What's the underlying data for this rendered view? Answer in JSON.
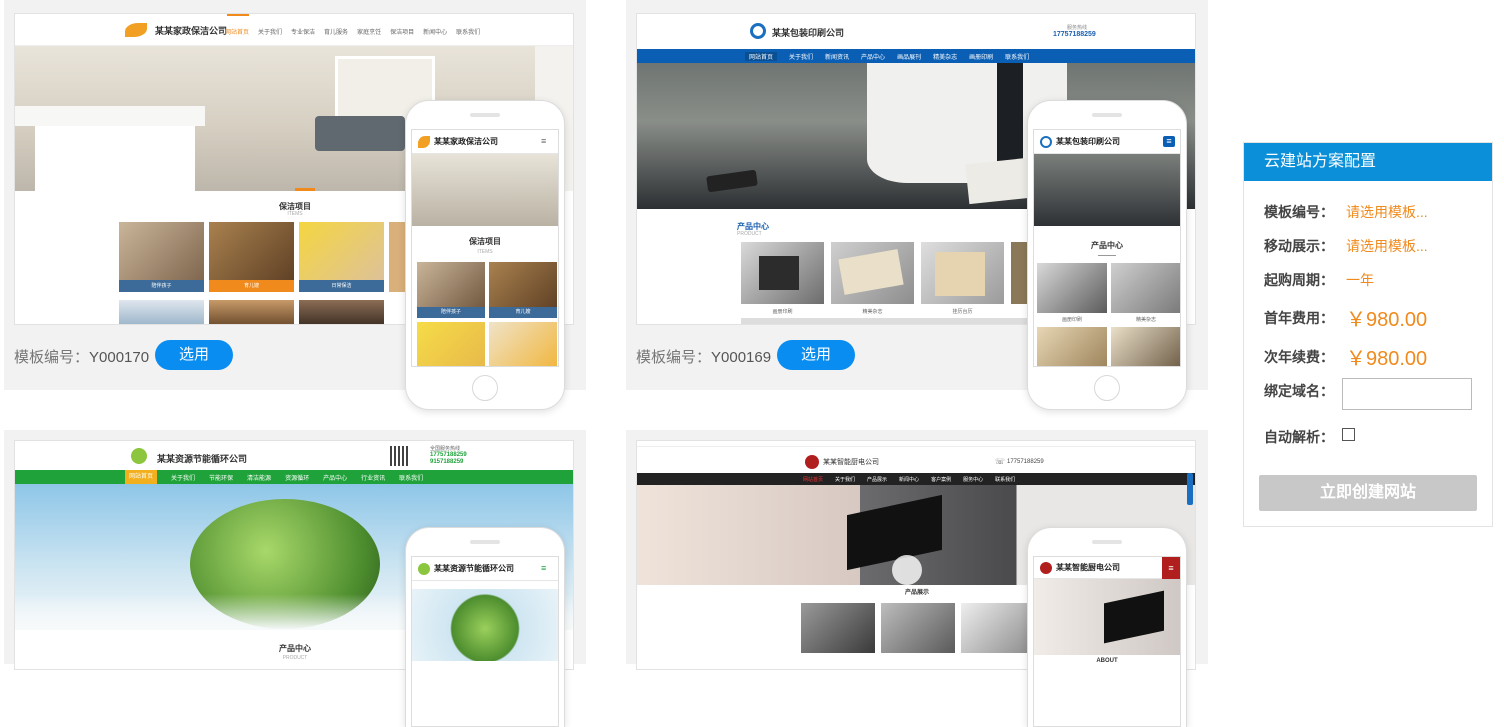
{
  "templates": [
    {
      "code_label": "模板编号：",
      "code": "Y000170",
      "select_label": "选用",
      "site_name": "某某家政保洁公司",
      "nav": [
        "网站首页",
        "关于我们",
        "专业保洁",
        "育儿服务",
        "家庭烹饪",
        "保洁项目",
        "新闻中心",
        "联系我们"
      ],
      "section_title": "保洁项目",
      "section_sub": "ITEMS",
      "tiles": [
        "陪伴孩子",
        "育儿嫂",
        "日常保洁"
      ],
      "mobile_section": "保洁项目",
      "mobile_sub": "ITEMS",
      "mobile_tiles": [
        "陪伴孩子",
        "育儿嫂"
      ]
    },
    {
      "code_label": "模板编号：",
      "code": "Y000169",
      "select_label": "选用",
      "site_name": "某某包装印刷公司",
      "phone_label": "服务热线",
      "phone": "17757188259",
      "nav": [
        "网站首页",
        "关于我们",
        "新闻资讯",
        "产品中心",
        "画品展刊",
        "精美杂志",
        "画册印刷",
        "联系我们"
      ],
      "section_title": "产品中心",
      "section_sub": "PRODUCT",
      "tiles": [
        "画册印刷",
        "精美杂志",
        "挂历台历"
      ],
      "mobile_section": "产品中心",
      "mobile_tiles": [
        "画册印刷",
        "精美杂志"
      ]
    },
    {
      "site_name": "某某资源节能循环公司",
      "phone_label": "全国服务热线",
      "phone": "17757188259",
      "phone2": "9157188259",
      "nav": [
        "网站首页",
        "关于我们",
        "节能环保",
        "清洁能源",
        "资源循环",
        "产品中心",
        "行业资讯",
        "联系我们"
      ],
      "section_title": "产品中心",
      "section_sub": "PRODUCT"
    },
    {
      "site_name": "某某智能厨电公司",
      "phone": "17757188259",
      "nav": [
        "网站首页",
        "关于我们",
        "产品展示",
        "新闻中心",
        "客户案例",
        "服务中心",
        "联系我们"
      ],
      "section_title": "产品展示",
      "mobile_section": "ABOUT"
    }
  ],
  "sidebar": {
    "title": "云建站方案配置",
    "template_code_label": "模板编号：",
    "template_code_value": "请选用模板...",
    "mobile_label": "移动展示：",
    "mobile_value": "请选用模板...",
    "period_label": "起购周期：",
    "period_value": "一年",
    "first_year_label": "首年费用：",
    "first_year_value": "￥980.00",
    "renew_label": "次年续费：",
    "renew_value": "￥980.00",
    "domain_label": "绑定域名：",
    "autoresolve_label": "自动解析：",
    "create_label": "立即创建网站"
  },
  "colors": {
    "accent": "#0a8df0",
    "panel_header": "#0a8fd8",
    "price": "#f08a1c",
    "nav_blue": "#0a5fb4",
    "nav_green": "#1fa23a",
    "nav_dark": "#222222"
  }
}
